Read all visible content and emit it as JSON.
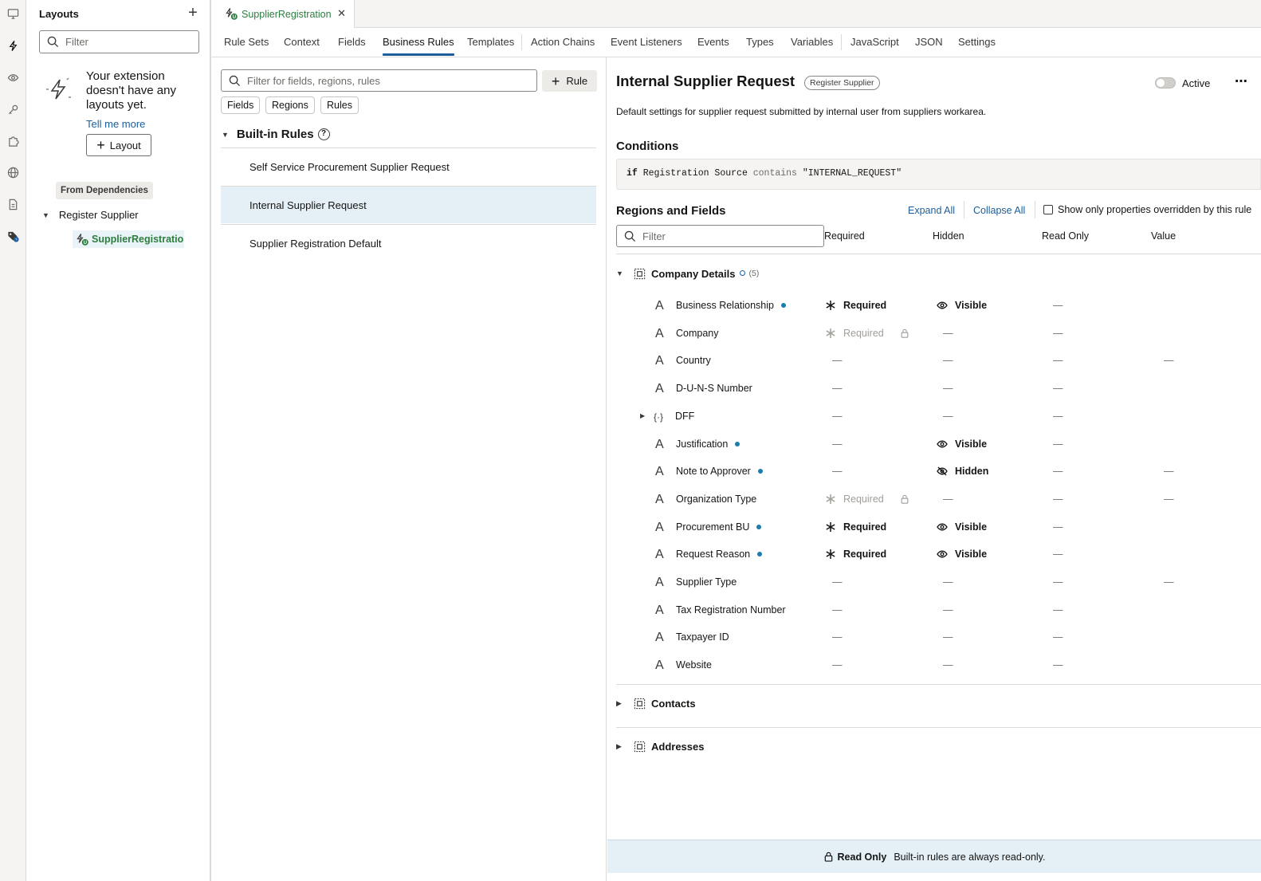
{
  "activity_bar": {
    "icons": [
      "monitor-icon",
      "lightning-icon",
      "eye-icon",
      "key-icon",
      "puzzle-icon",
      "globe-icon",
      "document-icon",
      "tags-icon"
    ]
  },
  "layouts_panel": {
    "title": "Layouts",
    "filter_placeholder": "Filter",
    "empty_text": "Your extension doesn't have any layouts yet.",
    "tell_more": "Tell me more",
    "layout_button": "Layout",
    "from_dependencies": "From Dependencies",
    "tree_parent": "Register Supplier",
    "tree_child": "SupplierRegistration"
  },
  "editor": {
    "file_tab": "SupplierRegistration",
    "nav_tabs": [
      "Rule Sets",
      "Context",
      "Fields",
      "Business Rules",
      "Templates",
      "Action Chains",
      "Event Listeners",
      "Events",
      "Types",
      "Variables",
      "JavaScript",
      "JSON",
      "Settings"
    ],
    "active_tab": "Business Rules"
  },
  "rules_pane": {
    "filter_placeholder": "Filter for fields, regions, rules",
    "rule_button": "Rule",
    "chips": [
      "Fields",
      "Regions",
      "Rules"
    ],
    "section": "Built-in Rules",
    "rules": [
      "Self Service Procurement Supplier Request",
      "Internal Supplier Request",
      "Supplier Registration Default"
    ],
    "selected_rule": "Internal Supplier Request"
  },
  "detail": {
    "title": "Internal Supplier Request",
    "badge": "Register Supplier",
    "active_label": "Active",
    "active_state": false,
    "description": "Default settings for supplier request submitted by internal user from suppliers workarea.",
    "conditions_heading": "Conditions",
    "condition": {
      "keyword": "if",
      "field": "Registration Source",
      "operator": "contains",
      "value": "\"INTERNAL_REQUEST\""
    },
    "regions_heading": "Regions and Fields",
    "expand_all": "Expand All",
    "collapse_all": "Collapse All",
    "show_only": "Show only properties overridden by this rule",
    "filter_placeholder": "Filter",
    "columns": [
      "Required",
      "Hidden",
      "Read Only",
      "Value"
    ],
    "groups": [
      {
        "name": "Company Details",
        "count": "(5)",
        "expanded": true
      },
      {
        "name": "Contacts",
        "expanded": false
      },
      {
        "name": "Addresses",
        "expanded": false
      }
    ],
    "fields": [
      {
        "name": "Business Relationship",
        "overridden": true,
        "required": "Required",
        "required_state": "on",
        "hidden": "Visible",
        "hidden_state": "visible",
        "readonly": "—",
        "value": ""
      },
      {
        "name": "Company",
        "overridden": false,
        "required": "Required",
        "required_state": "locked",
        "hidden": "—",
        "hidden_state": "none",
        "readonly": "—",
        "value": ""
      },
      {
        "name": "Country",
        "overridden": false,
        "required": "—",
        "required_state": "none",
        "hidden": "—",
        "hidden_state": "none",
        "readonly": "—",
        "value": "—"
      },
      {
        "name": "D-U-N-S Number",
        "overridden": false,
        "required": "—",
        "required_state": "none",
        "hidden": "—",
        "hidden_state": "none",
        "readonly": "—",
        "value": ""
      },
      {
        "name": "DFF",
        "overridden": false,
        "dff": true,
        "required": "—",
        "required_state": "none",
        "hidden": "—",
        "hidden_state": "none",
        "readonly": "—",
        "value": ""
      },
      {
        "name": "Justification",
        "overridden": true,
        "required": "—",
        "required_state": "none",
        "hidden": "Visible",
        "hidden_state": "visible",
        "readonly": "—",
        "value": ""
      },
      {
        "name": "Note to Approver",
        "overridden": true,
        "required": "—",
        "required_state": "none",
        "hidden": "Hidden",
        "hidden_state": "hidden",
        "readonly": "—",
        "value": "—"
      },
      {
        "name": "Organization Type",
        "overridden": false,
        "required": "Required",
        "required_state": "locked",
        "hidden": "—",
        "hidden_state": "none",
        "readonly": "—",
        "value": "—"
      },
      {
        "name": "Procurement BU",
        "overridden": true,
        "required": "Required",
        "required_state": "on",
        "hidden": "Visible",
        "hidden_state": "visible",
        "readonly": "—",
        "value": ""
      },
      {
        "name": "Request Reason",
        "overridden": true,
        "required": "Required",
        "required_state": "on",
        "hidden": "Visible",
        "hidden_state": "visible",
        "readonly": "—",
        "value": ""
      },
      {
        "name": "Supplier Type",
        "overridden": false,
        "required": "—",
        "required_state": "none",
        "hidden": "—",
        "hidden_state": "none",
        "readonly": "—",
        "value": "—"
      },
      {
        "name": "Tax Registration Number",
        "overridden": false,
        "required": "—",
        "required_state": "none",
        "hidden": "—",
        "hidden_state": "none",
        "readonly": "—",
        "value": ""
      },
      {
        "name": "Taxpayer ID",
        "overridden": false,
        "required": "—",
        "required_state": "none",
        "hidden": "—",
        "hidden_state": "none",
        "readonly": "—",
        "value": ""
      },
      {
        "name": "Website",
        "overridden": false,
        "required": "—",
        "required_state": "none",
        "hidden": "—",
        "hidden_state": "none",
        "readonly": "—",
        "value": ""
      }
    ]
  },
  "footer": {
    "label": "Read Only",
    "message": "Built-in rules are always read-only."
  },
  "colors": {
    "accent": "#1b5e9b",
    "green": "#2c7e3f",
    "selected_bg": "#e4f0f6",
    "dot": "#1b7cae"
  }
}
